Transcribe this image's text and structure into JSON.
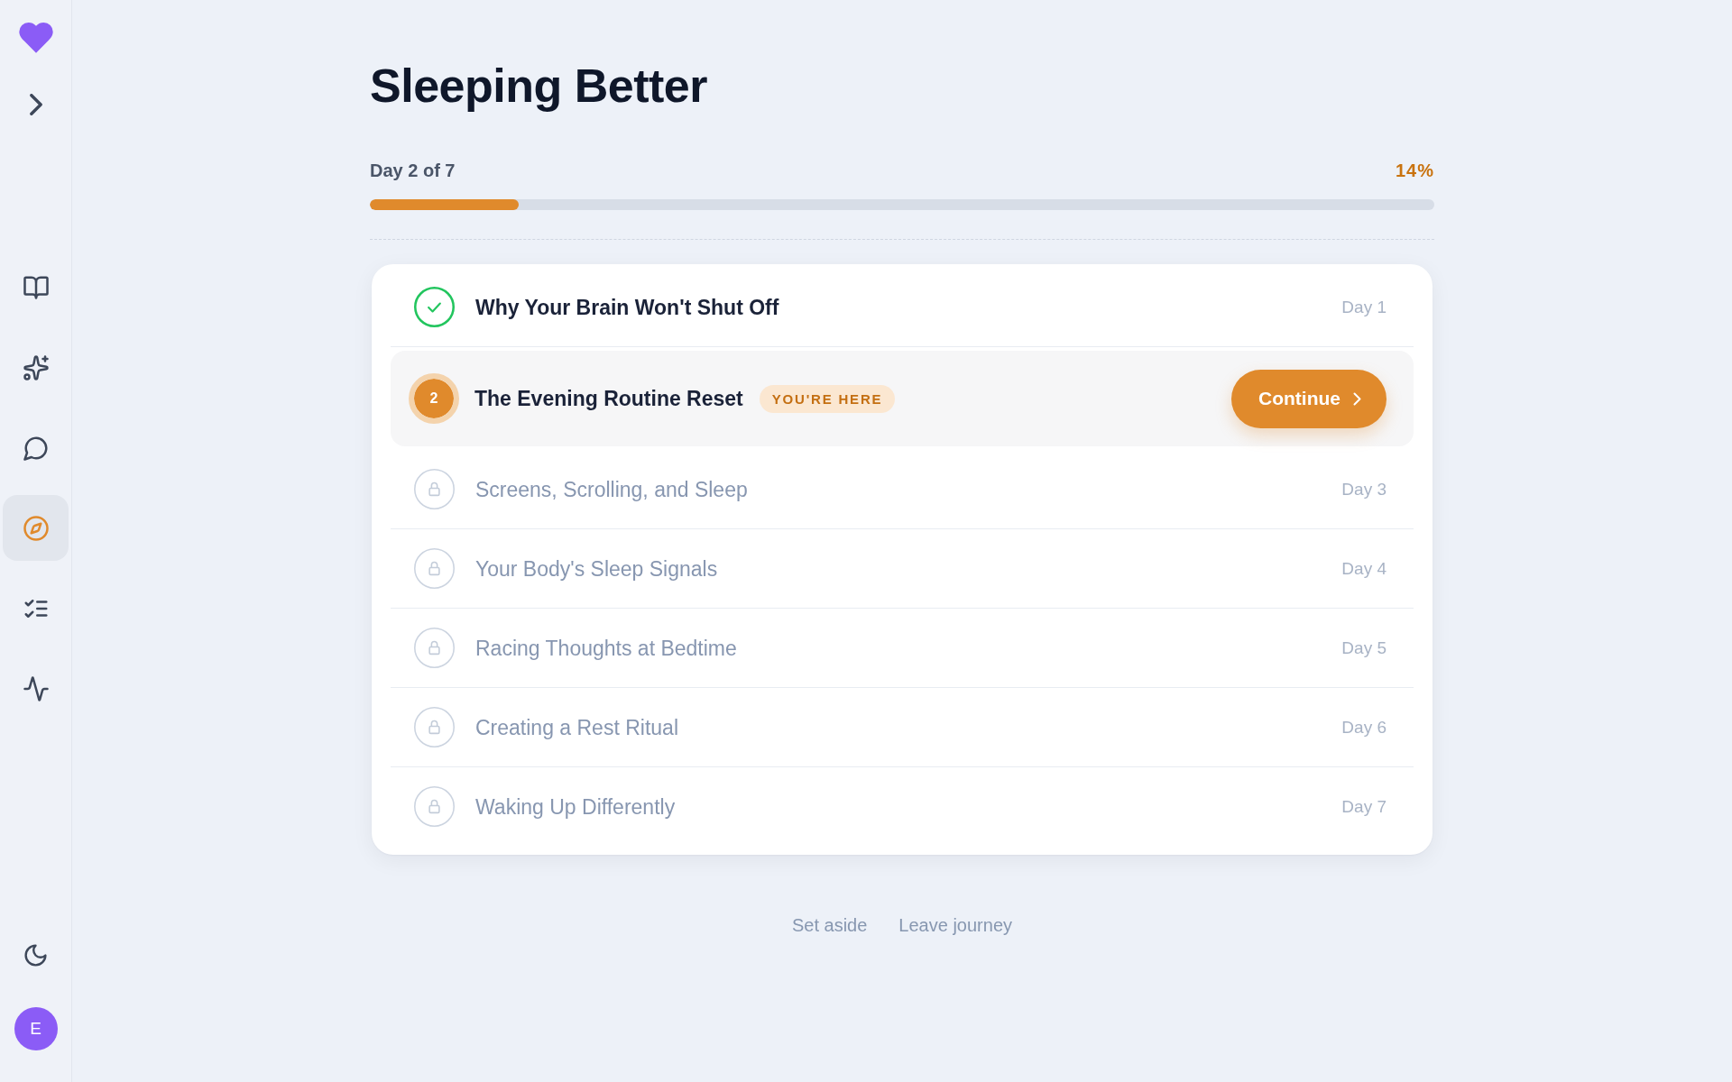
{
  "sidebar": {
    "nav": [
      {
        "kind": "book",
        "selected": false
      },
      {
        "kind": "sparkles",
        "selected": false
      },
      {
        "kind": "chat",
        "selected": false
      },
      {
        "kind": "compass",
        "selected": true
      },
      {
        "kind": "checklist",
        "selected": false
      },
      {
        "kind": "pulse",
        "selected": false
      }
    ],
    "avatar": {
      "initial": "E"
    }
  },
  "journey": {
    "title": "Sleeping Better",
    "progress": {
      "label": "Day 2 of 7",
      "percent": "14%",
      "level": 0.14
    }
  },
  "lessons": [
    {
      "kind": "done",
      "title": "Why Your Brain Won't Shut Off",
      "day": "Day 1"
    },
    {
      "kind": "current",
      "number": "2",
      "title": "The Evening Routine Reset",
      "badge": "YOU'RE HERE",
      "action": "Continue"
    },
    {
      "kind": "locked",
      "title": "Screens, Scrolling, and Sleep",
      "day": "Day 3"
    },
    {
      "kind": "locked",
      "title": "Your Body's Sleep Signals",
      "day": "Day 4"
    },
    {
      "kind": "locked",
      "title": "Racing Thoughts at Bedtime",
      "day": "Day 5"
    },
    {
      "kind": "locked",
      "title": "Creating a Rest Ritual",
      "day": "Day 6"
    },
    {
      "kind": "locked",
      "title": "Waking Up Differently",
      "day": "Day 7"
    }
  ],
  "footer_links": [
    "Set aside",
    "Leave journey"
  ]
}
